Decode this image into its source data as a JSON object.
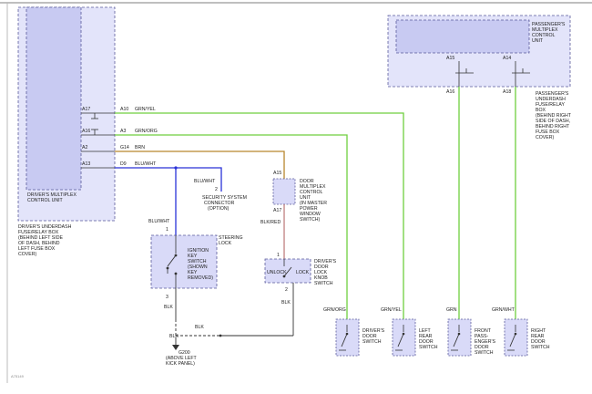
{
  "colors": {
    "module_fill": "#d9daf8",
    "module_fill_dark": "#c9cbf4",
    "module_stroke": "#4a4a8a",
    "wire_green": "#6fcf3f",
    "wire_orange": "#b8862e",
    "wire_blue": "#2a32d8",
    "wire_black": "#333333",
    "frame": "#aaaaaa"
  },
  "driver_unit": {
    "name": "DRIVER'S MULTIPLEX CONTROL UNIT",
    "box": "DRIVER'S UNDERDASH FUSE/RELAY BOX (BEHIND LEFT SIDE OF DASH, BEHIND LEFT FUSE BOX COVER)",
    "pins": [
      "A17",
      "A16",
      "A2",
      "A13"
    ]
  },
  "passenger_unit": {
    "name": "PASSENGER'S MULTIPLEX CONTROL UNIT",
    "box": "PASSENGER'S UNDERDASH FUSE/RELAY BOX (BEHIND RIGHT SIDE OF DASH, BEHIND RIGHT FUSE BOX COVER)",
    "pins": [
      "A15",
      "A14"
    ],
    "pins_out": [
      "A16",
      "A18"
    ]
  },
  "wires": {
    "grn_yel": "GRN/YEL",
    "grn_org": "GRN/ORG",
    "brn": "BRN",
    "blu_wht": "BLU/WHT",
    "blk_red": "BLK/RED",
    "blk": "BLK",
    "grn": "GRN",
    "grn_wht": "GRN/WHT"
  },
  "connectors": {
    "a10": "A10",
    "a3": "A3",
    "g14": "G14",
    "d9": "D9",
    "a15": "A15",
    "a17": "A17"
  },
  "security": {
    "pin": "2",
    "label": "SECURITY SYSTEM CONNECTOR (OPTION)"
  },
  "door_unit": {
    "name": "DOOR MULTIPLEX CONTROL UNIT (IN MASTER POWER WINDOW SWITCH)"
  },
  "steering_lock": {
    "name": "STEERING LOCK",
    "switch": "IGNITION KEY SWITCH (SHOWN KEY REMOVED)",
    "pin_top": "1",
    "pin_bottom": "3"
  },
  "knob_switch": {
    "name": "DRIVER'S DOOR LOCK KNOB SWITCH",
    "unlock": "UNLOCK",
    "lock": "LOCK",
    "pin_top": "1",
    "pin_bottom": "2"
  },
  "ground": {
    "name": "G200",
    "location": "(ABOVE LEFT KICK PANEL)"
  },
  "door_switches": {
    "driver": "DRIVER'S DOOR SWITCH",
    "left_rear": "LEFT REAR DOOR SWITCH",
    "front_passenger": "FRONT PASS-ENGER'S DOOR SWITCH",
    "right_rear": "RIGHT REAR DOOR SWITCH"
  },
  "figure_code": "A75149"
}
